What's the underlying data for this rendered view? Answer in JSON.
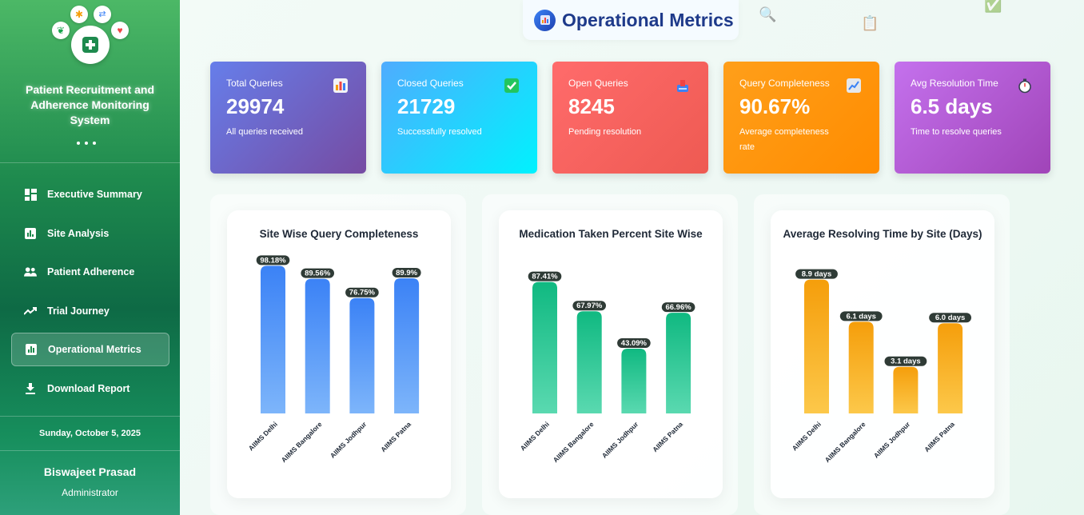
{
  "sidebar": {
    "title": "Patient Recruitment and Adherence Monitoring System",
    "nav": [
      {
        "label": "Executive Summary",
        "icon": "dashboard-icon",
        "active": false
      },
      {
        "label": "Site Analysis",
        "icon": "bar-chart-icon",
        "active": false
      },
      {
        "label": "Patient Adherence",
        "icon": "people-icon",
        "active": false
      },
      {
        "label": "Trial Journey",
        "icon": "trending-up-icon",
        "active": false
      },
      {
        "label": "Operational Metrics",
        "icon": "analytics-icon",
        "active": true
      },
      {
        "label": "Download Report",
        "icon": "download-icon",
        "active": false
      }
    ],
    "date": "Sunday, October 5, 2025",
    "user": {
      "name": "Biswajeet Prasad",
      "role": "Administrator"
    }
  },
  "header": {
    "title": "Operational Metrics",
    "icon": "chart-icon"
  },
  "cards": [
    {
      "label": "Total Queries",
      "value": "29974",
      "sub": "All queries received",
      "icon": "bar-chart-icon",
      "from": "#667eea",
      "to": "#764ba2"
    },
    {
      "label": "Closed Queries",
      "value": "21729",
      "sub": "Successfully resolved",
      "icon": "check-icon",
      "from": "#4facfe",
      "to": "#00f2fe"
    },
    {
      "label": "Open Queries",
      "value": "8245",
      "sub": "Pending resolution",
      "icon": "inbox-icon",
      "from": "#ff6b6b",
      "to": "#ee5a52"
    },
    {
      "label": "Query Completeness",
      "value": "90.67%",
      "sub": "Average completeness rate",
      "icon": "trend-icon",
      "from": "#ff9f1a",
      "to": "#ff8c00"
    },
    {
      "label": "Avg Resolution Time",
      "value": "6.5 days",
      "sub": "Time to resolve queries",
      "icon": "stopwatch-icon",
      "from": "#c471ed",
      "to": "#a044b8"
    }
  ],
  "chart_data": [
    {
      "type": "bar",
      "title": "Site Wise Query Completeness",
      "categories": [
        "AIIMS Delhi",
        "AIIMS Bangalore",
        "AIIMS Jodhpur",
        "AIIMS Patna"
      ],
      "values": [
        98.18,
        89.56,
        76.75,
        89.9
      ],
      "labels": [
        "98.18%",
        "89.56%",
        "76.75%",
        "89.9%"
      ],
      "ylim": [
        0,
        100
      ],
      "colors": [
        "#3b82f6",
        "#7db5fa"
      ]
    },
    {
      "type": "bar",
      "title": "Medication Taken Percent Site Wise",
      "categories": [
        "AIIMS Delhi",
        "AIIMS Bangalore",
        "AIIMS Jodhpur",
        "AIIMS Patna"
      ],
      "values": [
        87.41,
        67.97,
        43.09,
        66.96
      ],
      "labels": [
        "87.41%",
        "67.97%",
        "43.09%",
        "66.96%"
      ],
      "ylim": [
        0,
        100
      ],
      "colors": [
        "#10b981",
        "#5ad9b0"
      ]
    },
    {
      "type": "bar",
      "title": "Average Resolving Time by Site (Days)",
      "categories": [
        "AIIMS Delhi",
        "AIIMS Bangalore",
        "AIIMS Jodhpur",
        "AIIMS Patna"
      ],
      "values": [
        8.9,
        6.1,
        3.1,
        6.0
      ],
      "labels": [
        "8.9 days",
        "6.1 days",
        "3.1 days",
        "6.0 days"
      ],
      "ylim": [
        0,
        10
      ],
      "colors": [
        "#f59e0b",
        "#fcc84a"
      ]
    }
  ]
}
